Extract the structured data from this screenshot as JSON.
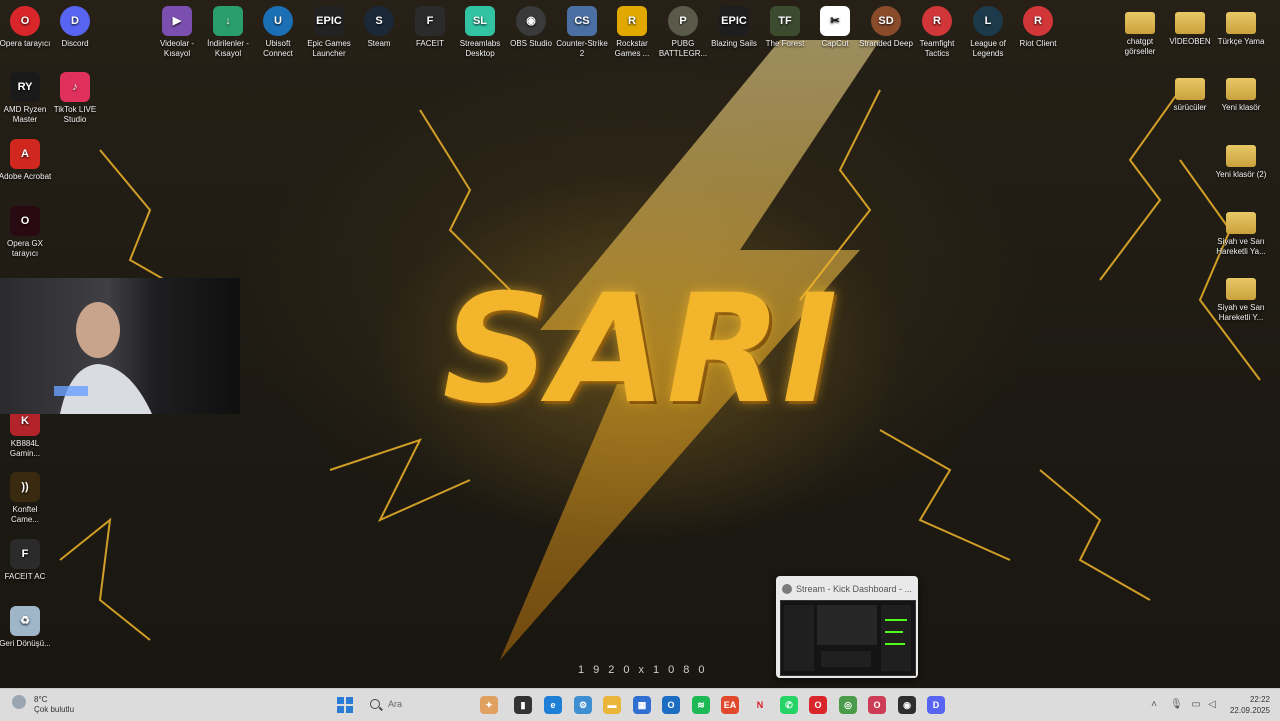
{
  "desktop": {
    "icons_top": [
      {
        "label": "Opera tarayıcı",
        "color": "#d9262b",
        "icon": "opera-icon",
        "glyph": "O",
        "shape": "circ"
      },
      {
        "label": "Discord",
        "color": "#5865f2",
        "icon": "discord-icon",
        "glyph": "D",
        "shape": "circ"
      },
      {
        "label": "Videolar - Kısayol",
        "color": "#7b4fb0",
        "icon": "video-folder-icon",
        "glyph": "▶",
        "shape": ""
      },
      {
        "label": "İndirilenler - Kısayol",
        "color": "#2a9d6d",
        "icon": "download-folder-icon",
        "glyph": "↓",
        "shape": ""
      },
      {
        "label": "Ubisoft Connect",
        "color": "#1b6fb5",
        "icon": "ubisoft-icon",
        "glyph": "U",
        "shape": "circ"
      },
      {
        "label": "Epic Games Launcher",
        "color": "#222222",
        "icon": "epic-games-icon",
        "glyph": "EPIC",
        "shape": ""
      },
      {
        "label": "Steam",
        "color": "#1b2838",
        "icon": "steam-icon",
        "glyph": "S",
        "shape": "circ"
      },
      {
        "label": "FACEIT",
        "color": "#2b2b2b",
        "icon": "faceit-icon",
        "glyph": "F",
        "shape": ""
      },
      {
        "label": "Streamlabs Desktop",
        "color": "#31c3a2",
        "icon": "streamlabs-icon",
        "glyph": "SL",
        "shape": ""
      },
      {
        "label": "OBS Studio",
        "color": "#3a3a3a",
        "icon": "obs-icon",
        "glyph": "◉",
        "shape": "circ"
      },
      {
        "label": "Counter-Strike 2",
        "color": "#4b6fa3",
        "icon": "counter-strike-icon",
        "glyph": "CS",
        "shape": ""
      },
      {
        "label": "Rockstar Games ...",
        "color": "#e0a800",
        "icon": "rockstar-icon",
        "glyph": "R",
        "shape": ""
      },
      {
        "label": "PUBG BATTLEGR...",
        "color": "#5a5a4a",
        "icon": "pubg-icon",
        "glyph": "P",
        "shape": "circ"
      },
      {
        "label": "Blazing Sails",
        "color": "#1e1e1e",
        "icon": "epic-games-icon",
        "glyph": "EPIC",
        "shape": ""
      },
      {
        "label": "The Forest",
        "color": "#3c4a2e",
        "icon": "the-forest-icon",
        "glyph": "TF",
        "shape": ""
      },
      {
        "label": "CapCut",
        "color": "#ffffff",
        "icon": "capcut-icon",
        "glyph": "✂",
        "shape": ""
      },
      {
        "label": "Stranded Deep",
        "color": "#8a4b2a",
        "icon": "stranded-deep-icon",
        "glyph": "SD",
        "shape": "circ"
      },
      {
        "label": "Teamfight Tactics",
        "color": "#d13639",
        "icon": "riot-icon",
        "glyph": "R",
        "shape": "circ"
      },
      {
        "label": "League of Legends",
        "color": "#1c3a4a",
        "icon": "league-icon",
        "glyph": "L",
        "shape": "circ"
      },
      {
        "label": "Riot Client",
        "color": "#d13639",
        "icon": "riot-icon",
        "glyph": "R",
        "shape": "circ"
      }
    ],
    "icons_left": [
      {
        "label": "AMD Ryzen Master",
        "color": "#1a1a1a",
        "icon": "ryzen-icon",
        "glyph": "RY"
      },
      {
        "label": "TikTok LIVE Studio",
        "color": "#e0305c",
        "icon": "tiktok-icon",
        "glyph": "♪"
      },
      {
        "label": "Adobe Acrobat",
        "color": "#d0281f",
        "icon": "acrobat-icon",
        "glyph": "A"
      },
      {
        "label": "Opera GX tarayıcı",
        "color": "#2a0a12",
        "icon": "opera-gx-icon",
        "glyph": "O"
      },
      {
        "label": "KB884L Gamin...",
        "color": "#b3242a",
        "icon": "keyboard-icon",
        "glyph": "K"
      },
      {
        "label": "Konftel Came...",
        "color": "#3a2a10",
        "icon": "konftel-icon",
        "glyph": "))"
      },
      {
        "label": "FACEIT AC",
        "color": "#2b2b2b",
        "icon": "faceit-ac-icon",
        "glyph": "F"
      },
      {
        "label": "Geri Dönüşü...",
        "color": "#9fb6c8",
        "icon": "recycle-bin-icon",
        "glyph": "♻"
      }
    ],
    "icons_right": [
      {
        "label": "chatgpt görseller",
        "icon": "folder-icon"
      },
      {
        "label": "VİDEOBEN",
        "icon": "folder-icon"
      },
      {
        "label": "Türkçe Yama",
        "icon": "folder-icon"
      },
      {
        "label": "sürücüler",
        "icon": "folder-icon"
      },
      {
        "label": "Yeni klasör",
        "icon": "folder-icon"
      },
      {
        "label": "Yeni klasör (2)",
        "icon": "folder-icon"
      },
      {
        "label": "Siyah ve Sarı Hareketli Ya...",
        "icon": "video-file-icon"
      },
      {
        "label": "Siyah ve Sarı Hareketli Y...",
        "icon": "video-file-icon"
      }
    ],
    "wallpaper_text": "SARI",
    "resolution_text": "1920x1080",
    "accent": "#f5b820"
  },
  "task_preview": {
    "title": "Stream - Kick Dashboard - ..."
  },
  "taskbar": {
    "weather_temp": "8°C",
    "weather_desc": "Çok bulutlu",
    "search_placeholder": "Ara",
    "apps": [
      {
        "name": "widget-app-icon",
        "color": "#e0a060",
        "glyph": "✦"
      },
      {
        "name": "task-view-icon",
        "color": "#333333",
        "glyph": "▮"
      },
      {
        "name": "edge-icon",
        "color": "#1e7fd6",
        "glyph": "e"
      },
      {
        "name": "settings-app-icon",
        "color": "#3d8fd1",
        "glyph": "⚙"
      },
      {
        "name": "file-explorer-icon",
        "color": "#e9b63b",
        "glyph": "▬"
      },
      {
        "name": "microsoft-store-icon",
        "color": "#2f6fd1",
        "glyph": "▦"
      },
      {
        "name": "outlook-icon",
        "color": "#1d6ec2",
        "glyph": "O"
      },
      {
        "name": "spotify-icon",
        "color": "#1db954",
        "glyph": "≋"
      },
      {
        "name": "ea-app-icon",
        "color": "#e0492c",
        "glyph": "EA"
      },
      {
        "name": "netflix-icon",
        "color": "#dcdcdc",
        "glyph": "N"
      },
      {
        "name": "whatsapp-icon",
        "color": "#25d366",
        "glyph": "✆"
      },
      {
        "name": "opera-icon",
        "color": "#d9262b",
        "glyph": "O"
      },
      {
        "name": "chrome-icon",
        "color": "#4a9b4a",
        "glyph": "◎"
      },
      {
        "name": "opera-gx-icon",
        "color": "#cc3d55",
        "glyph": "O"
      },
      {
        "name": "obs-icon",
        "color": "#2e2e2e",
        "glyph": "◉"
      },
      {
        "name": "discord-icon",
        "color": "#5865f2",
        "glyph": "D"
      }
    ],
    "time": "22:22",
    "date": "22.09.2025"
  }
}
